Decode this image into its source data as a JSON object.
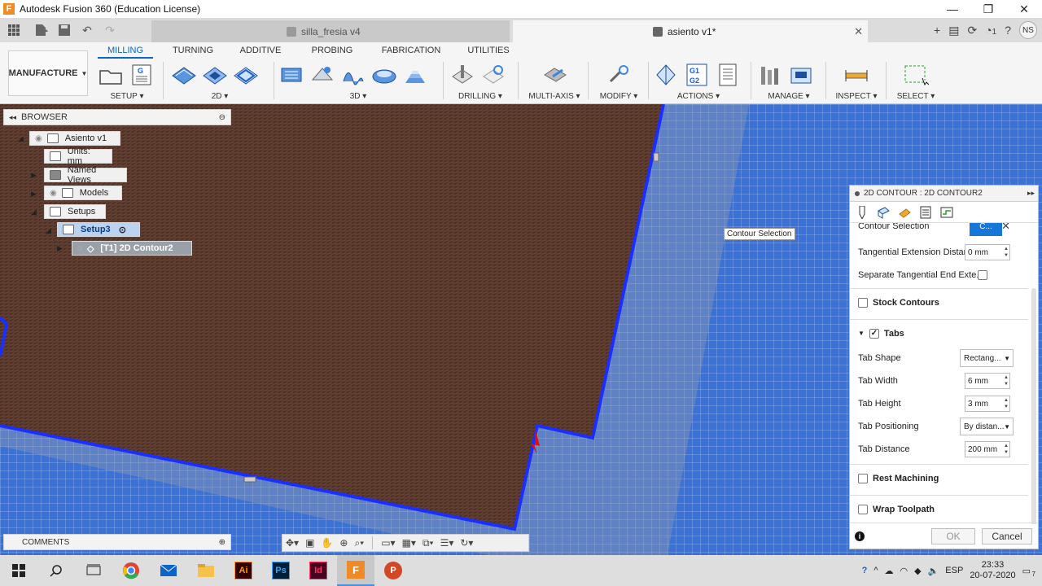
{
  "window": {
    "title": "Autodesk Fusion 360 (Education License)",
    "controls": [
      "—",
      "❐",
      "✕"
    ]
  },
  "doc_tabs": [
    {
      "name": "silla_fresia v4",
      "active": false
    },
    {
      "name": "asiento v1*",
      "active": true
    }
  ],
  "user_initials": "NS",
  "job_count": "1",
  "ribbon": {
    "workspace": "MANUFACTURE",
    "tabs": [
      "MILLING",
      "TURNING",
      "ADDITIVE",
      "PROBING",
      "FABRICATION",
      "UTILITIES"
    ],
    "active_tab": "MILLING",
    "groups": [
      "SETUP",
      "2D",
      "3D",
      "DRILLING",
      "MULTI-AXIS",
      "MODIFY",
      "ACTIONS",
      "MANAGE",
      "INSPECT",
      "SELECT"
    ]
  },
  "browser": {
    "title": "BROWSER",
    "items": [
      {
        "label": "Asiento v1"
      },
      {
        "label": "Units: mm"
      },
      {
        "label": "Named Views"
      },
      {
        "label": "Models"
      },
      {
        "label": "Setups"
      },
      {
        "label": "Setup3"
      },
      {
        "label": "[T1] 2D Contour2"
      }
    ]
  },
  "tooltip": "Contour Selection",
  "dialog": {
    "title": "2D CONTOUR : 2D CONTOUR2",
    "contour_selection": {
      "label": "Contour Selection",
      "button": "C..."
    },
    "tangential_extension": {
      "label": "Tangential Extension Distance",
      "value": "0 mm"
    },
    "separate_tangential": {
      "label": "Separate Tangential End Exte...",
      "checked": false
    },
    "stock_contours": {
      "label": "Stock Contours",
      "checked": false
    },
    "tabs": {
      "label": "Tabs",
      "checked": true,
      "shape": {
        "label": "Tab Shape",
        "value": "Rectang..."
      },
      "width": {
        "label": "Tab Width",
        "value": "6 mm"
      },
      "height": {
        "label": "Tab Height",
        "value": "3 mm"
      },
      "positioning": {
        "label": "Tab Positioning",
        "value": "By distan..."
      },
      "distance": {
        "label": "Tab Distance",
        "value": "200 mm"
      }
    },
    "rest_machining": {
      "label": "Rest Machining",
      "checked": false
    },
    "wrap_toolpath": {
      "label": "Wrap Toolpath",
      "checked": false
    },
    "ok": "OK",
    "cancel": "Cancel"
  },
  "comments": "COMMENTS",
  "taskbar": {
    "apps": [
      "start",
      "search",
      "task-view",
      "chrome",
      "mail",
      "explorer",
      "Ai",
      "Ps",
      "Id",
      "F",
      "P"
    ],
    "language": "ESP",
    "time": "23:33",
    "date": "20-07-2020",
    "notifications": "7"
  },
  "colors": {
    "accent": "#0a66c2",
    "toolpath": "#1a2fff",
    "wood": "#5a3a2c",
    "grid_bg": "#3c72d6"
  }
}
